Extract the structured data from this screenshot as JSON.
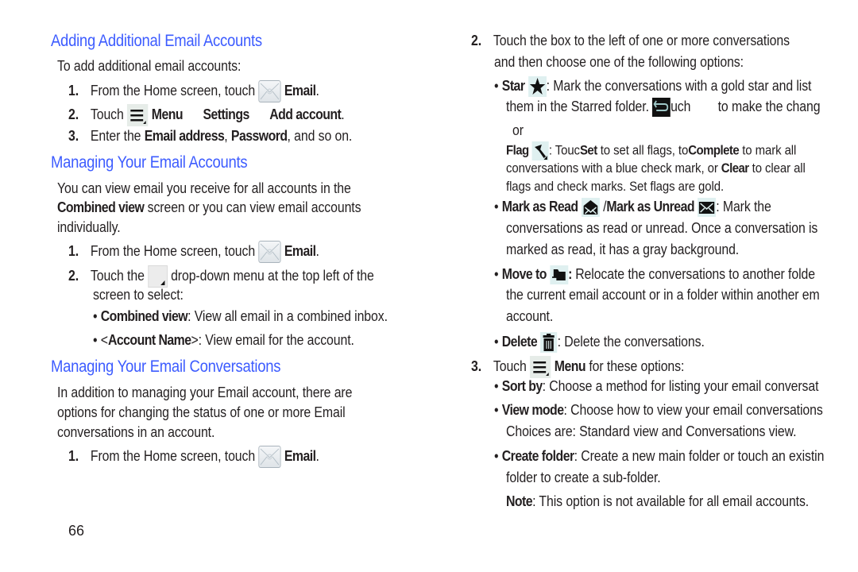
{
  "page_number": "66",
  "left": {
    "section1": {
      "heading": "Adding Additional Email Accounts",
      "intro": "To add additional email accounts:",
      "steps": [
        {
          "num": "1.",
          "pre": "From the Home screen, touch",
          "bold": "Email",
          "post": "."
        },
        {
          "num": "2.",
          "pre": "Touch",
          "menu": "Menu",
          "settings": "Settings",
          "add": "Add account",
          "post": "."
        },
        {
          "num": "3.",
          "pre": "Enter the",
          "bold1": "Email address",
          "sep": ",",
          "bold2": "Password",
          "post": ", and so on."
        }
      ]
    },
    "section2": {
      "heading": "Managing Your Email Accounts",
      "para_line1": "You can view email you receive for all accounts in the",
      "para_bold": "Combined view",
      "para_line2": " screen or you can view email accounts",
      "para_line3": "individually.",
      "steps": [
        {
          "num": "1.",
          "pre": "From the Home screen, touch",
          "bold": "Email",
          "post": "."
        },
        {
          "num": "2.",
          "pre": "Touch the",
          "post": "drop-down menu at the top left of the",
          "line2": "screen to select:"
        }
      ],
      "bullets": [
        {
          "bold": "Combined view",
          "text": ": View all email in a combined inbox."
        },
        {
          "pre": "<",
          "bold": "Account Name",
          "text": ">: View email for the account."
        }
      ]
    },
    "section3": {
      "heading": "Managing Your Email Conversations",
      "para_line1": "In addition to managing your Email account, there are",
      "para_line2": "options for changing the status of one or more Email",
      "para_line3": "conversations in an account.",
      "steps": [
        {
          "num": "1.",
          "pre": "From the Home screen, touch",
          "bold": "Email",
          "post": "."
        }
      ]
    }
  },
  "right": {
    "step2": {
      "num": "2.",
      "line1": "Touch the box to the left of one or more conversations",
      "line2": "and then choose one of the following options:"
    },
    "star": {
      "bold": "Star",
      "line1": ": Mark the conversations with a gold star and list",
      "line2a": "them in the Starred folder.",
      "line2b": "uch",
      "line2c": "to make the chang",
      "or": "or"
    },
    "flag": {
      "bold": "Flag",
      "pre": ": Touc",
      "set": "Set",
      "mid1": "to set all flags, to",
      "complete": "Complete",
      "mid2": "to mark all",
      "line2a": "conversations with a blue check mark, or",
      "clear": "Clear",
      "line2b": "to clear all",
      "line3": "flags and check marks. Set flags are gold."
    },
    "markread": {
      "bold1": "Mark as Read",
      "sep": "/",
      "bold2": "Mark as Unread",
      "line1": ": Mark the",
      "line2": "conversations as read or unread. Once a conversation is",
      "line3": "marked as read, it has a gray background."
    },
    "moveto": {
      "bold": "Move to",
      "colon": ":",
      "line1": " Relocate the conversations to another folde",
      "line2": "the current email account or in a folder within another em",
      "line3": "account."
    },
    "delete": {
      "bold": "Delete",
      "text": ": Delete the conversations."
    },
    "step3": {
      "num": "3.",
      "pre": "Touch",
      "menu": "Menu",
      "post": "for these options:"
    },
    "menu_bullets": [
      {
        "bold": "Sort by",
        "text": ": Choose a method for listing your email conversat"
      },
      {
        "bold": "View mode",
        "text": ": Choose how to view your email conversations",
        "line2": "Choices are: Standard view and Conversations view."
      },
      {
        "bold": "Create folder",
        "text": ": Create a new main folder or touch an existin",
        "line2": "folder to create a sub-folder."
      }
    ],
    "note": {
      "bold": "Note",
      "text": ": This option is not available for all email accounts."
    }
  }
}
